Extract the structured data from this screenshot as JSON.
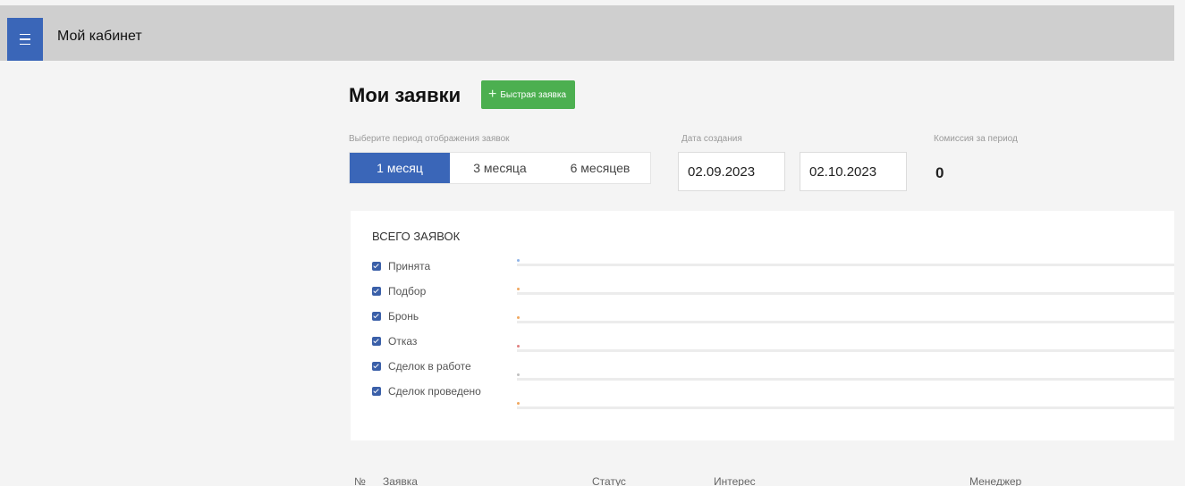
{
  "header": {
    "title": "Мой кабинет"
  },
  "page": {
    "title": "Мои заявки",
    "quick_button": "Быстрая заявка"
  },
  "filters": {
    "period_label": "Выберите период отображения заявок",
    "periods": [
      "1 месяц",
      "3 месяца",
      "6 месяцев"
    ],
    "active_period": "1 месяц",
    "date_label": "Дата создания",
    "date_from": "02.09.2023",
    "date_to": "02.10.2023",
    "commission_label": "Комиссия за период",
    "commission_value": "0"
  },
  "chart_data": {
    "type": "line",
    "title": "ВСЕГО ЗАЯВОК",
    "series": [
      {
        "name": "Принята",
        "color": "#8fb4e8",
        "values": []
      },
      {
        "name": "Подбор",
        "color": "#f0a860",
        "values": []
      },
      {
        "name": "Бронь",
        "color": "#f0a860",
        "values": []
      },
      {
        "name": "Отказ",
        "color": "#e08080",
        "values": []
      },
      {
        "name": "Сделок в работе",
        "color": "#c0c0c0",
        "values": []
      },
      {
        "name": "Сделок проведено",
        "color": "#f0a860",
        "values": []
      }
    ],
    "checked": [
      true,
      true,
      true,
      true,
      true,
      true
    ],
    "legend_position": "left",
    "grid": false
  },
  "table": {
    "columns": [
      "№",
      "Заявка",
      "Статус",
      "Интерес",
      "Менеджер"
    ]
  },
  "colors": {
    "accent": "#3a66b8",
    "success": "#4caf50"
  }
}
